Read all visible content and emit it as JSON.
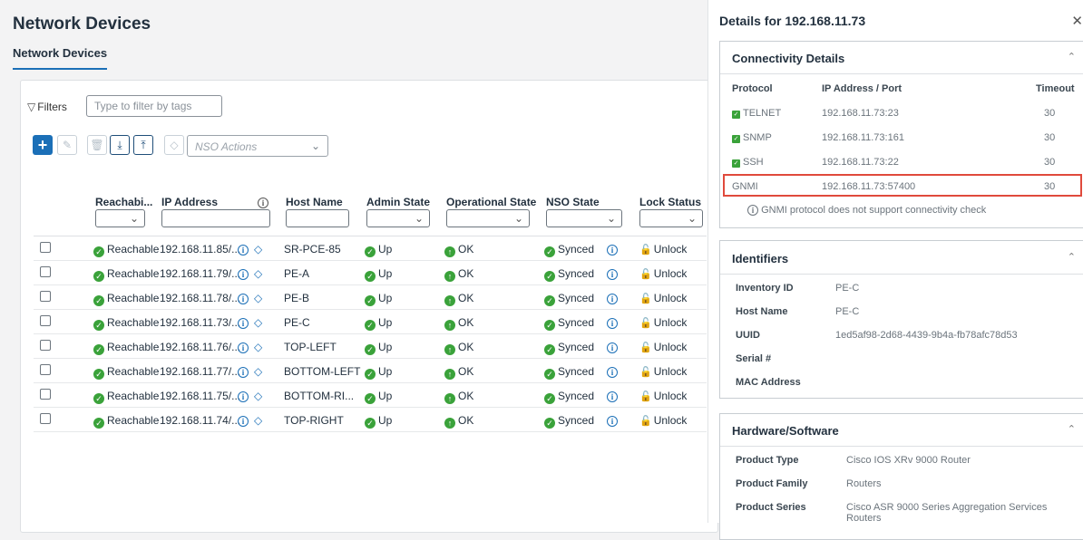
{
  "page": {
    "title": "Network Devices",
    "subtab": "Network Devices"
  },
  "toolbar": {
    "filters_label": "Filters",
    "tag_filter_placeholder": "Type to filter by tags",
    "nso_actions_placeholder": "NSO Actions"
  },
  "table": {
    "headers": {
      "reachability": "Reachabi...",
      "ip": "IP Address",
      "host": "Host Name",
      "admin": "Admin State",
      "oper": "Operational State",
      "nso": "NSO State",
      "lock": "Lock Status"
    },
    "rows": [
      {
        "reach": "Reachable",
        "ip": "192.168.11.85/...",
        "host": "SR-PCE-85",
        "admin": "Up",
        "oper": "OK",
        "nso": "Synced",
        "lock": "Unlock"
      },
      {
        "reach": "Reachable",
        "ip": "192.168.11.79/...",
        "host": "PE-A",
        "admin": "Up",
        "oper": "OK",
        "nso": "Synced",
        "lock": "Unlock"
      },
      {
        "reach": "Reachable",
        "ip": "192.168.11.78/...",
        "host": "PE-B",
        "admin": "Up",
        "oper": "OK",
        "nso": "Synced",
        "lock": "Unlock"
      },
      {
        "reach": "Reachable",
        "ip": "192.168.11.73/...",
        "host": "PE-C",
        "admin": "Up",
        "oper": "OK",
        "nso": "Synced",
        "lock": "Unlock"
      },
      {
        "reach": "Reachable",
        "ip": "192.168.11.76/...",
        "host": "TOP-LEFT",
        "admin": "Up",
        "oper": "OK",
        "nso": "Synced",
        "lock": "Unlock"
      },
      {
        "reach": "Reachable",
        "ip": "192.168.11.77/...",
        "host": "BOTTOM-LEFT",
        "admin": "Up",
        "oper": "OK",
        "nso": "Synced",
        "lock": "Unlock"
      },
      {
        "reach": "Reachable",
        "ip": "192.168.11.75/...",
        "host": "BOTTOM-RI...",
        "admin": "Up",
        "oper": "OK",
        "nso": "Synced",
        "lock": "Unlock"
      },
      {
        "reach": "Reachable",
        "ip": "192.168.11.74/...",
        "host": "TOP-RIGHT",
        "admin": "Up",
        "oper": "OK",
        "nso": "Synced",
        "lock": "Unlock"
      }
    ]
  },
  "panel": {
    "title": "Details for 192.168.11.73",
    "connectivity": {
      "title": "Connectivity Details",
      "headers": {
        "protocol": "Protocol",
        "ip_port": "IP Address / Port",
        "timeout": "Timeout"
      },
      "rows": [
        {
          "protocol": "TELNET",
          "ip_port": "192.168.11.73:23",
          "timeout": "30",
          "checked": true
        },
        {
          "protocol": "SNMP",
          "ip_port": "192.168.11.73:161",
          "timeout": "30",
          "checked": true
        },
        {
          "protocol": "SSH",
          "ip_port": "192.168.11.73:22",
          "timeout": "30",
          "checked": true
        },
        {
          "protocol": "GNMI",
          "ip_port": "192.168.11.73:57400",
          "timeout": "30",
          "checked": false
        }
      ],
      "note": "GNMI protocol does not support connectivity check"
    },
    "identifiers": {
      "title": "Identifiers",
      "items": [
        {
          "key": "Inventory ID",
          "value": "PE-C"
        },
        {
          "key": "Host Name",
          "value": "PE-C"
        },
        {
          "key": "UUID",
          "value": "1ed5af98-2d68-4439-9b4a-fb78afc78d53"
        },
        {
          "key": "Serial #",
          "value": ""
        },
        {
          "key": "MAC Address",
          "value": ""
        }
      ]
    },
    "hardware": {
      "title": "Hardware/Software",
      "items": [
        {
          "key": "Product Type",
          "value": "Cisco IOS XRv 9000 Router"
        },
        {
          "key": "Product Family",
          "value": "Routers"
        },
        {
          "key": "Product Series",
          "value": "Cisco ASR 9000 Series Aggregation Services Routers"
        }
      ]
    }
  },
  "colors": {
    "accent": "#1b6fb7",
    "ok_green": "#3aa23a",
    "highlight_red": "#e04a3c"
  }
}
